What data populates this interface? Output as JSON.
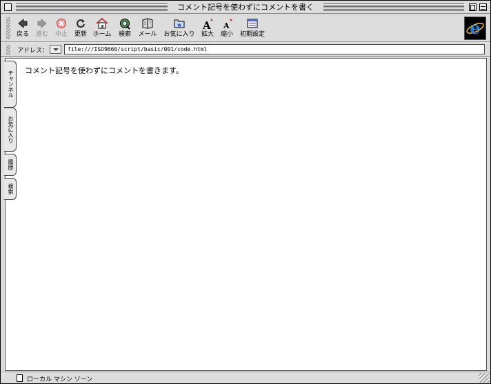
{
  "window": {
    "title": "コメント記号を使わずにコメントを書く"
  },
  "toolbar": {
    "buttons": [
      {
        "label": "戻る",
        "icon": "back-arrow-icon",
        "enabled": true
      },
      {
        "label": "進む",
        "icon": "forward-arrow-icon",
        "enabled": false
      },
      {
        "label": "中止",
        "icon": "stop-icon",
        "enabled": false
      },
      {
        "label": "更新",
        "icon": "refresh-icon",
        "enabled": true
      },
      {
        "label": "ホーム",
        "icon": "home-icon",
        "enabled": true
      },
      {
        "label": "検索",
        "icon": "search-icon",
        "enabled": true
      },
      {
        "label": "メール",
        "icon": "mail-icon",
        "enabled": true
      },
      {
        "label": "お気に入り",
        "icon": "favorites-icon",
        "enabled": true
      },
      {
        "label": "拡大",
        "icon": "text-larger-icon",
        "enabled": true
      },
      {
        "label": "縮小",
        "icon": "text-smaller-icon",
        "enabled": true
      },
      {
        "label": "初期設定",
        "icon": "preferences-icon",
        "enabled": true
      }
    ],
    "logo_icon": "internet-explorer-logo-icon"
  },
  "address": {
    "label": "アドレス：",
    "url": "file:///ISO9660/script/basic/001/code.html"
  },
  "content": {
    "text": "コメント記号を使わずにコメントを書きます。"
  },
  "side_tabs": [
    {
      "label": "チャンネル"
    },
    {
      "label": "お気に入り"
    },
    {
      "label": "履歴"
    },
    {
      "label": "検索"
    }
  ],
  "status": {
    "zone": "ローカル マシン ゾーン"
  },
  "colors": {
    "chrome": "#dddddd",
    "stop_red": "#e03030",
    "ie_blue": "#2a7fd4"
  }
}
